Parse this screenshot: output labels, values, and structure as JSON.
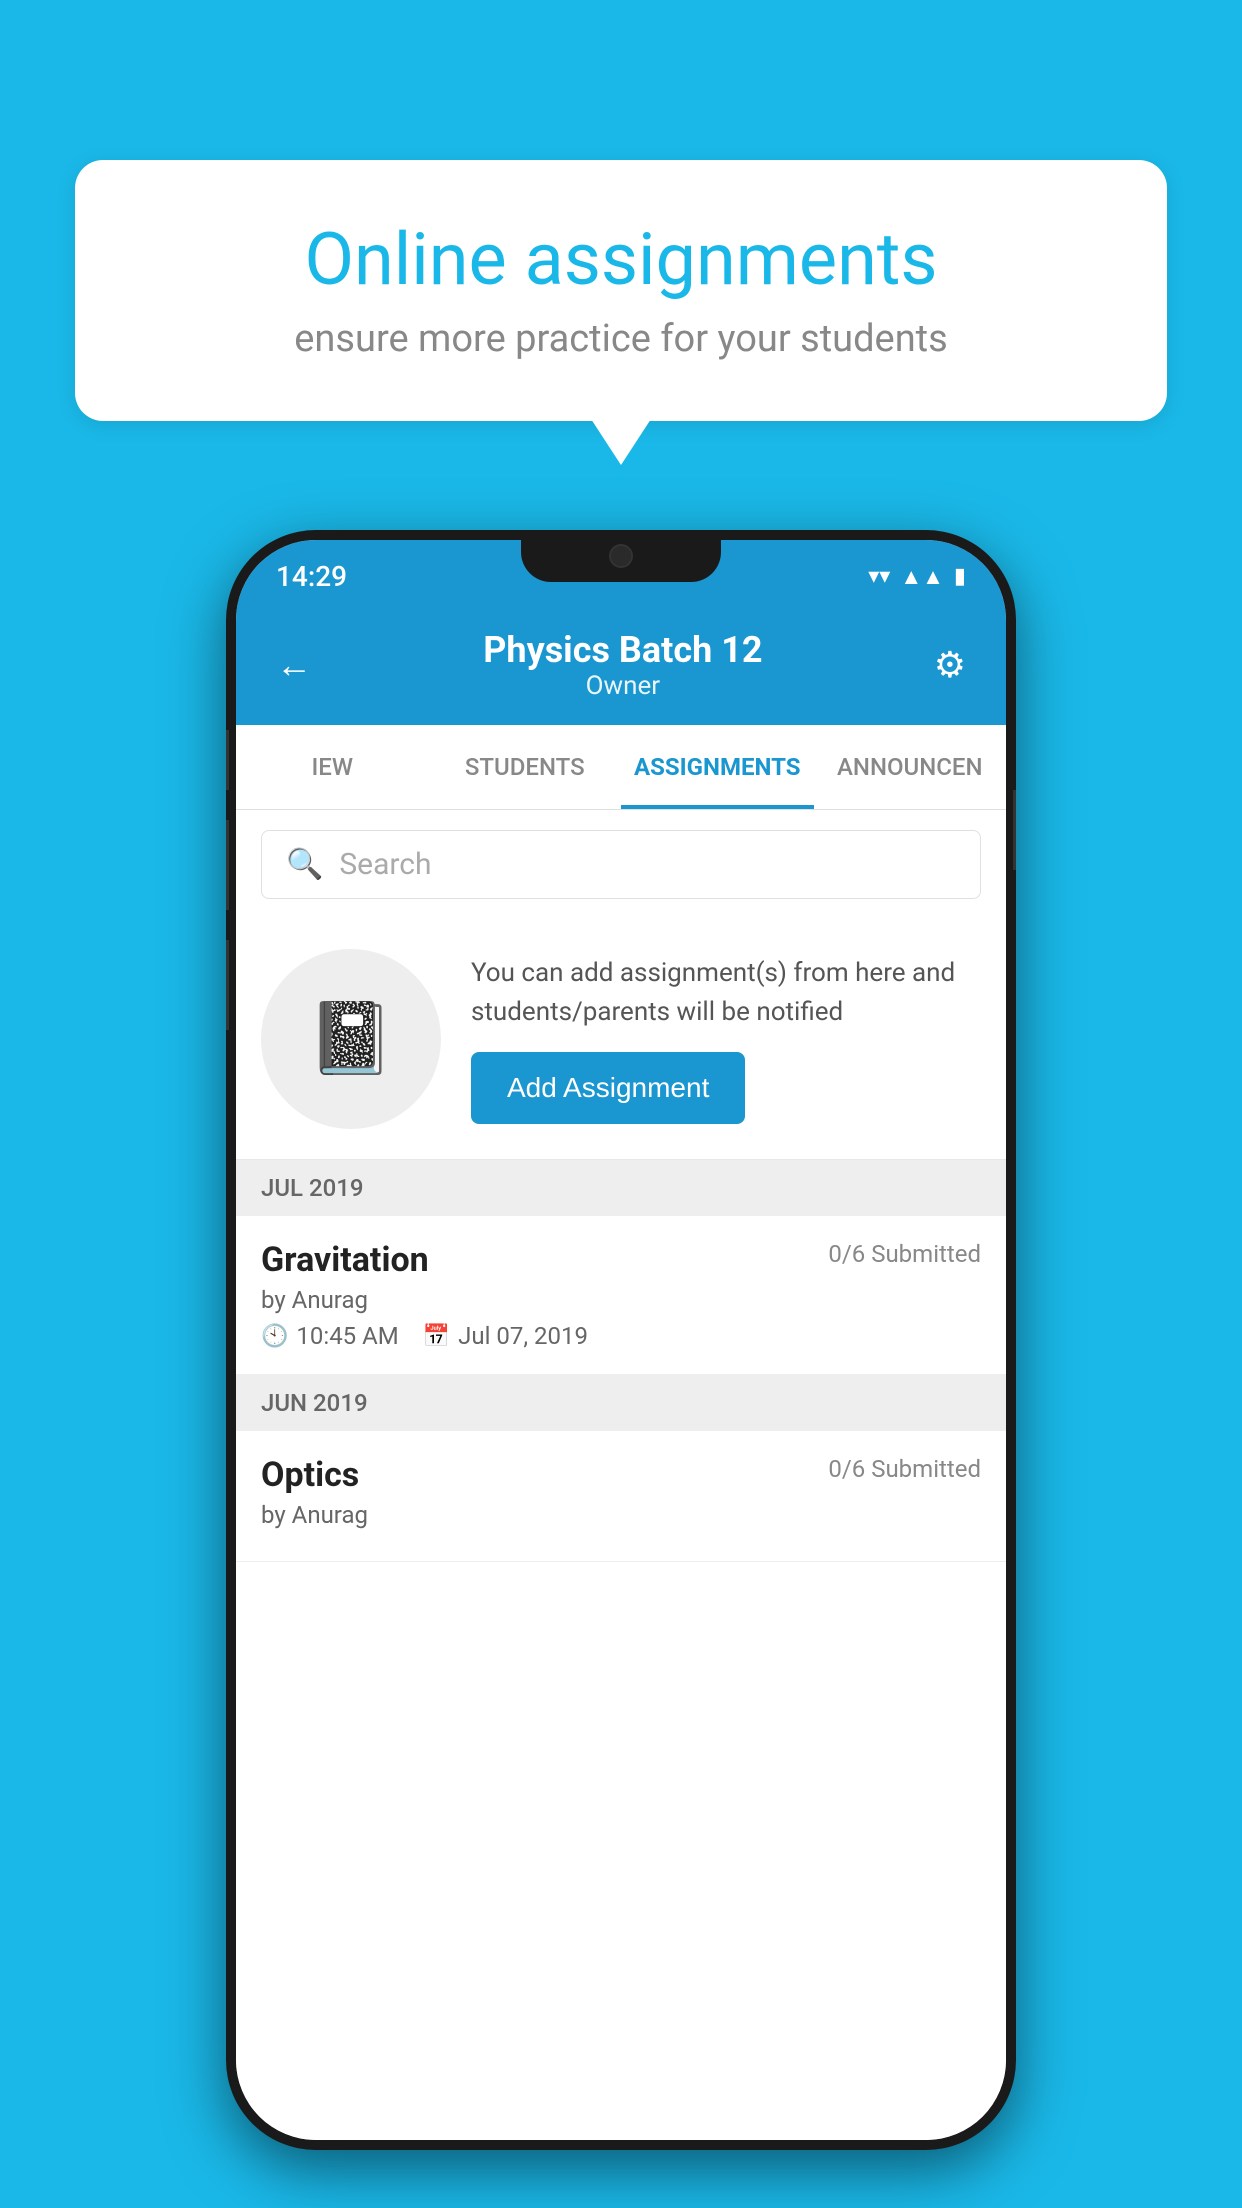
{
  "background_color": "#1ab8e8",
  "speech_bubble": {
    "title": "Online assignments",
    "subtitle": "ensure more practice for your students"
  },
  "phone": {
    "status_bar": {
      "time": "14:29",
      "wifi": "▼",
      "signal": "▲",
      "battery": "▮"
    },
    "header": {
      "back_label": "←",
      "title": "Physics Batch 12",
      "subtitle": "Owner",
      "settings_label": "⚙"
    },
    "tabs": [
      {
        "label": "IEW",
        "active": false
      },
      {
        "label": "STUDENTS",
        "active": false
      },
      {
        "label": "ASSIGNMENTS",
        "active": true
      },
      {
        "label": "ANNOUNCEN",
        "active": false
      }
    ],
    "search": {
      "placeholder": "Search"
    },
    "promo": {
      "description": "You can add assignment(s) from here and students/parents will be notified",
      "button_label": "Add Assignment"
    },
    "sections": [
      {
        "header": "JUL 2019",
        "assignments": [
          {
            "title": "Gravitation",
            "submitted": "0/6 Submitted",
            "by": "by Anurag",
            "time": "10:45 AM",
            "date": "Jul 07, 2019"
          }
        ]
      },
      {
        "header": "JUN 2019",
        "assignments": [
          {
            "title": "Optics",
            "submitted": "0/6 Submitted",
            "by": "by Anurag",
            "time": "",
            "date": ""
          }
        ]
      }
    ]
  }
}
